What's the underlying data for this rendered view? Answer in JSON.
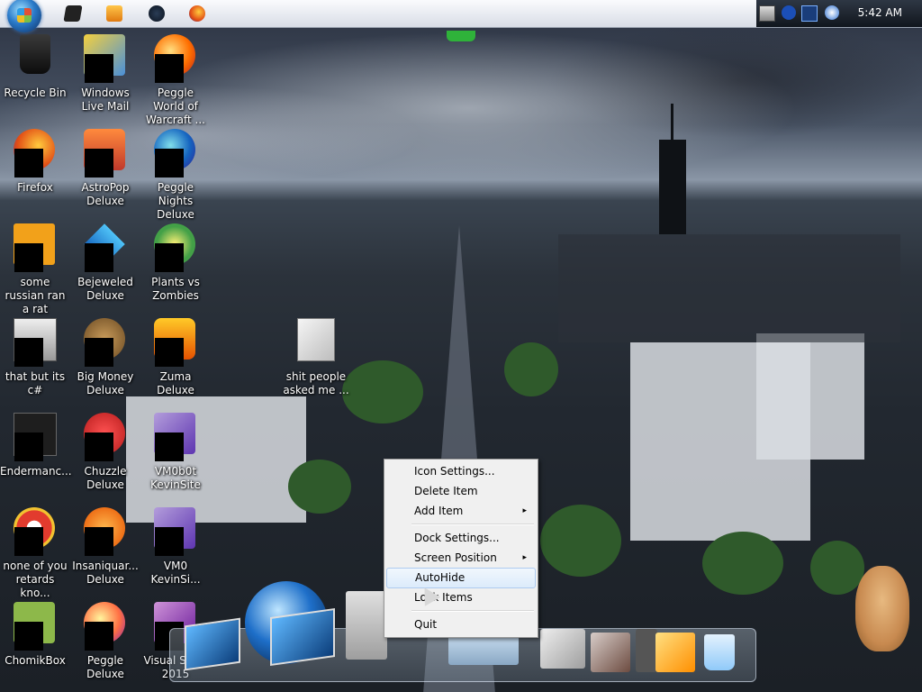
{
  "taskbar": {
    "clock": "5:42 AM"
  },
  "desktop_icons": [
    {
      "label": "Recycle Bin",
      "icon": "recycle-bin-icon"
    },
    {
      "label": "Windows Live Mail",
      "icon": "windows-live-mail-icon"
    },
    {
      "label": "Peggle World of Warcraft ...",
      "icon": "peggle-wow-icon"
    },
    {
      "label": "Firefox",
      "icon": "firefox-icon"
    },
    {
      "label": "AstroPop Deluxe",
      "icon": "astropop-icon"
    },
    {
      "label": "Peggle Nights Deluxe",
      "icon": "peggle-nights-icon"
    },
    {
      "label": "some russian ran a rat",
      "icon": "file-icon"
    },
    {
      "label": "Bejeweled Deluxe",
      "icon": "bejeweled-icon"
    },
    {
      "label": "Plants vs Zombies",
      "icon": "plants-vs-zombies-icon"
    },
    {
      "label": "that but its c#",
      "icon": "folder-stack-icon"
    },
    {
      "label": "Big Money Deluxe",
      "icon": "big-money-icon"
    },
    {
      "label": "Zuma Deluxe",
      "icon": "zuma-icon"
    },
    {
      "label": "shit people asked me ...",
      "icon": "document-icon"
    },
    {
      "label": "Endermanc...",
      "icon": "console-icon"
    },
    {
      "label": "Chuzzle Deluxe",
      "icon": "chuzzle-icon"
    },
    {
      "label": "VM0b0t KevinSite",
      "icon": "visual-studio-icon"
    },
    {
      "label": "none of you retards kno...",
      "icon": "chrome-icon"
    },
    {
      "label": "Insaniquar... Deluxe",
      "icon": "insaniquarium-icon"
    },
    {
      "label": "VM0 KevinSi...",
      "icon": "visual-studio-icon"
    },
    {
      "label": "ChomikBox",
      "icon": "chomikbox-icon"
    },
    {
      "label": "Peggle Deluxe",
      "icon": "peggle-icon"
    },
    {
      "label": "Visual Stu... 2015",
      "icon": "visual-studio-icon"
    }
  ],
  "context_menu": {
    "items": [
      {
        "label": "Icon Settings...",
        "submenu": false
      },
      {
        "label": "Delete Item",
        "submenu": false
      },
      {
        "label": "Add Item",
        "submenu": true
      },
      {
        "label": "Dock Settings...",
        "submenu": false
      },
      {
        "label": "Screen Position",
        "submenu": true
      },
      {
        "label": "AutoHide",
        "submenu": false,
        "highlighted": true
      },
      {
        "label": "Lock Items",
        "submenu": false
      },
      {
        "label": "Quit",
        "submenu": false
      }
    ],
    "arrow": "▸"
  },
  "dock": {
    "items": [
      "computer-icon",
      "globe-icon",
      "monitor-icon",
      "folder-icon",
      "documents-icon",
      "pictures-icon",
      "tools-icon",
      "settings-icon",
      "hammer-wrench-icon",
      "recycle-bin-icon"
    ]
  },
  "colors": {
    "menu_bg": "#f0f0f0",
    "menu_highlight": "#dcebfb",
    "tray_bg": "#11161d"
  }
}
